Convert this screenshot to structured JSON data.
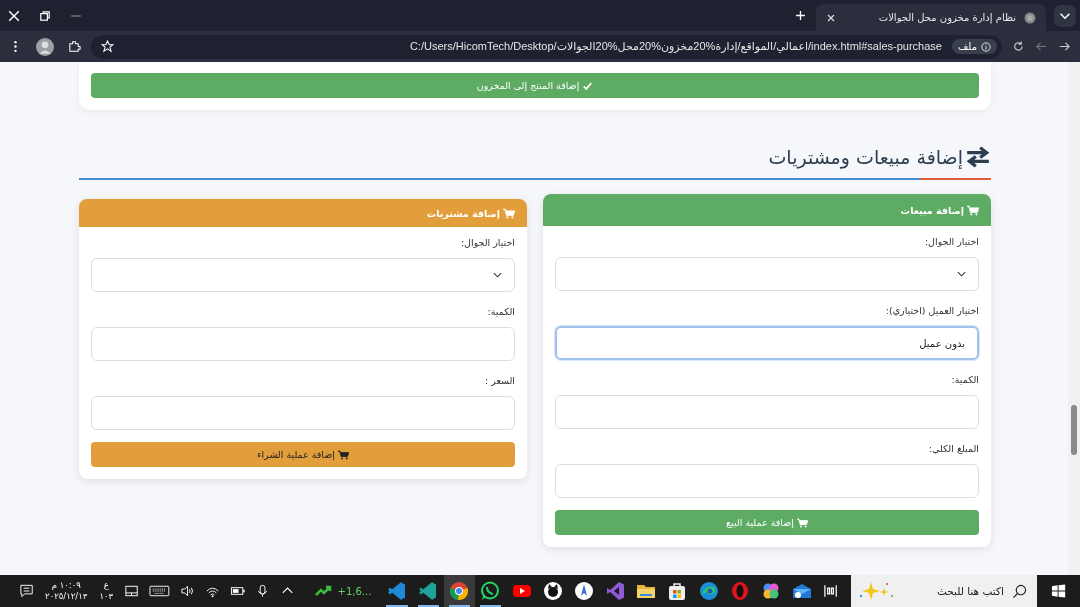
{
  "browser": {
    "tab": {
      "title": "نظام إدارة مخزون محل الجوالات",
      "selected": true
    },
    "address_bar": {
      "chip": "ملف",
      "url": "C:/Users/HicomTech/Desktop/اعمالي/المواقع/إدارة%20مخزون%20محل%20الجوالات/index.html#sales-purchase"
    }
  },
  "page": {
    "top_button": "إضافة المنتج إلى المخزون",
    "section_title": "إضافة مبيعات ومشتريات",
    "cards": [
      {
        "kind": "sales",
        "title": "إضافة مبيعات",
        "fields": [
          {
            "kind": "select",
            "label": "اختيار الجوال:",
            "focused": false
          },
          {
            "kind": "text",
            "label": "اختيار العميل (اختياري):",
            "value": "بدون عميل",
            "focused": true
          },
          {
            "kind": "text",
            "label": "الكمية:",
            "focused": false
          },
          {
            "kind": "text",
            "label": "المبلغ الكلي:",
            "focused": false
          }
        ],
        "button": "إضافة عملية البيع"
      },
      {
        "kind": "purchase",
        "title": "إضافة مشتريات",
        "fields": [
          {
            "kind": "select",
            "label": "اختيار الجوال:",
            "focused": false
          },
          {
            "kind": "text",
            "label": "الكمية:",
            "focused": false
          },
          {
            "kind": "text",
            "label": "السعر :",
            "focused": false
          }
        ],
        "button": "إضافة عملية الشراء"
      }
    ]
  },
  "taskbar": {
    "time": "١٠:٠٩ م",
    "date": "٢٠٢٥/١٢/١٣",
    "language": "ع",
    "language_sub": "١٠٣",
    "stocks": "+1,6...",
    "search_placeholder": "اكتب هنا للبحث",
    "apps": [
      {
        "kind": "code-blue",
        "running": true,
        "selected": false
      },
      {
        "kind": "code-teal",
        "running": true,
        "selected": false
      },
      {
        "kind": "browser",
        "running": true,
        "selected": true
      },
      {
        "kind": "chat",
        "running": true,
        "selected": false
      },
      {
        "kind": "video",
        "running": false,
        "selected": false
      },
      {
        "kind": "cat",
        "running": false,
        "selected": false
      },
      {
        "kind": "compass",
        "running": false,
        "selected": false
      },
      {
        "kind": "studio",
        "running": false,
        "selected": false
      },
      {
        "kind": "folder",
        "running": false,
        "selected": false
      },
      {
        "kind": "store",
        "running": false,
        "selected": false
      },
      {
        "kind": "wave",
        "running": false,
        "selected": false
      },
      {
        "kind": "ring",
        "running": false,
        "selected": false
      },
      {
        "kind": "flower",
        "running": false,
        "selected": false
      },
      {
        "kind": "mail",
        "running": false,
        "selected": false
      }
    ]
  }
}
